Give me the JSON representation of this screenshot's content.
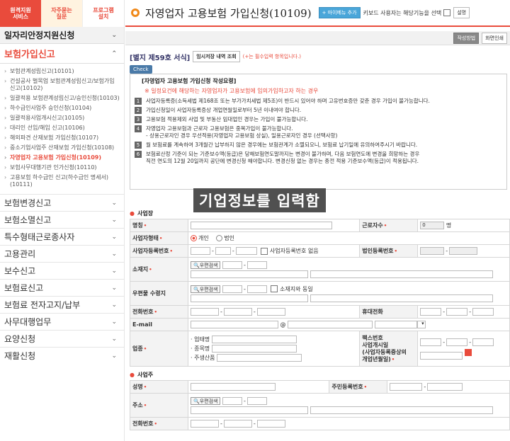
{
  "sidebar": {
    "top_buttons": [
      "원격지원\n서비스",
      "자주묻는\n질문",
      "프로그램\n설치"
    ],
    "main_menu": "일자리안정지원신청",
    "active_menu": "보험가입신고",
    "sub_items": [
      "보험관계성립신고(10101)",
      "건설공사 벌목업 보험관계성립신고/보험가입 신고(10102)",
      "일괄적용 보험관계성립신고/승인신청(10103)",
      "하수급인사업주 승인신청(10104)",
      "일괄적용사업개시신고(10105)",
      "대리인 선임/해임 신고(10106)",
      "해외파견 산재보험 가입신청(10107)",
      "중소기업사업주 산재보험 가입신청(10108)",
      "자영업자 고용보험 가입신청(10109)",
      "보험사무대행기관 인가신청(10110)",
      "고용보험 하수급인 신고(하수급인 명세서)(10111)"
    ],
    "categories": [
      "보험변경신고",
      "보험소멸신고",
      "특수형태근로종사자",
      "고용관리",
      "보수신고",
      "보험료신고",
      "보험료 전자고지/납부",
      "사무대행업무",
      "요양신청",
      "재활신청"
    ]
  },
  "header": {
    "title": "자영업자 고용보험 가입신청(10109)",
    "add_menu_btn": "+ 마이메뉴 추가",
    "keyboard_text": "키보드 사용자는 해당기능을 선택",
    "explain_btn": "설명"
  },
  "toolbar": {
    "write_method": "작성방법",
    "print": "화면인쇄"
  },
  "form": {
    "form_no": "[별지 제59호 서식]",
    "temp_btn": "임시저장 내역 조회",
    "req_note": "(+는 필수입력 항목입니다.)",
    "check_tag": "Check",
    "notice_title": "[자영업자 고용보험 가입신청 작성요령]",
    "notice_sub": "※ 일정요건에 해당하는 자영업자가 고용보험에 임의가입하고자 하는 경우",
    "notices": [
      "사업자등록증(소득세법 제168조 또는 부가가치세법 제5조)이 반드시 있어야 하며 고유번호증만 갖춘 경우 가입이 불가능합니다.",
      "가입신청일이 사업자등록증상 개업연월일로부터 5년 이내여야 합니다.",
      "고용보험 적용제외 사업 및 부동산 임대업인 경우는 가입이 불가능합니다.",
      "자영업자 고용보험과 근로자 고용보험은 중복가입이 불가능합니다.\n- 상용근로자인 경우 우선적용(자영업자 고용보험 상실), 일용근로자인 경우 (선택사항)",
      "월 보험료를 계속하여 3개월간 납부하지 않은 경우에는 보험관계가 소멸되오니, 보험료 납기일에 유의하여주시기 바랍니다.",
      "보험료산정 기준이 되는 기준보수액(등급)은 당해보험연도말까지는 변경이 불가하며, 다음 보험연도에 변경을 희망하는 경우\n직전 연도의 12월 20일까지 공단에 변경신청 해야합니다. 변경신청 없는 경우는 종전 적용 기준보수액(등급)이 적용됩니다."
    ],
    "overlay_text": "기업정보를 입력함",
    "sec_business": "사업장",
    "sec_owner": "사업주",
    "labels": {
      "name": "명칭",
      "workers": "근로자수",
      "workers_value": "0",
      "workers_unit": "명",
      "biz_type": "사업자형태",
      "personal": "개인",
      "corp": "법인",
      "biz_reg_no": "사업자등록번호",
      "no_biz_reg": "사업자등록번호 없음",
      "corp_reg_no": "법인등록번호",
      "address": "소재지",
      "zip_search": "우편검색",
      "mail_receiver": "우편물 수령지",
      "same_addr": "소재지와 동일",
      "phone": "전화번호",
      "mobile": "휴대전화",
      "email": "E-mail",
      "at": "@",
      "industry": "업종",
      "ind_type": "· 업태명",
      "ind_item": "· 종목명",
      "ind_product": "· 주생산품",
      "fax": "팩스번호",
      "start_date": "사업개시일\n(사업자등록증상의\n개업년월일)",
      "owner_name": "성명",
      "rrn": "주민등록번호",
      "owner_addr": "주소",
      "owner_phone": "전화번호"
    }
  }
}
